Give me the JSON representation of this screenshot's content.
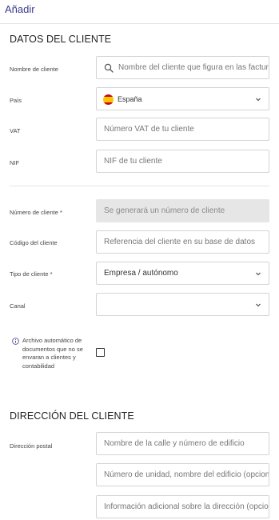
{
  "header": {
    "title": "Añadir"
  },
  "client_data": {
    "title": "DATOS DEL CLIENTE",
    "name": {
      "label": "Nombre de cliente",
      "placeholder": "Nombre del cliente que figura en las facturas"
    },
    "country": {
      "label": "País",
      "value": "España"
    },
    "vat": {
      "label": "VAT",
      "placeholder": "Número VAT de tu cliente"
    },
    "nif": {
      "label": "NIF",
      "placeholder": "NIF de tu cliente"
    },
    "client_number": {
      "label": "Número de cliente *",
      "value": "Se generará un número de cliente"
    },
    "client_code": {
      "label": "Código del cliente",
      "placeholder": "Referencia del cliente en su base de datos"
    },
    "client_type": {
      "label": "Tipo de cliente *",
      "value": "Empresa / autónomo"
    },
    "channel": {
      "label": "Canal",
      "value": ""
    },
    "auto_archive": {
      "lines": [
        "Archivo automático de",
        "documentos que no se",
        "envaran a clientes y",
        "contabilidad"
      ],
      "checked": false
    }
  },
  "client_address": {
    "title": "DIRECCIÓN DEL CLIENTE",
    "postal_label": "Dirección postal",
    "street_placeholder": "Nombre de la calle y número de edificio",
    "unit_placeholder": "Número de unidad, nombre del edificio (opcional)",
    "extra_placeholder": "Información adicional sobre la dirección (opcional)"
  },
  "colors": {
    "accent": "#3d3a8c",
    "info_icon": "#3d3a8c",
    "border": "#d4d4d4",
    "disabled_bg": "#e6e6e6"
  }
}
